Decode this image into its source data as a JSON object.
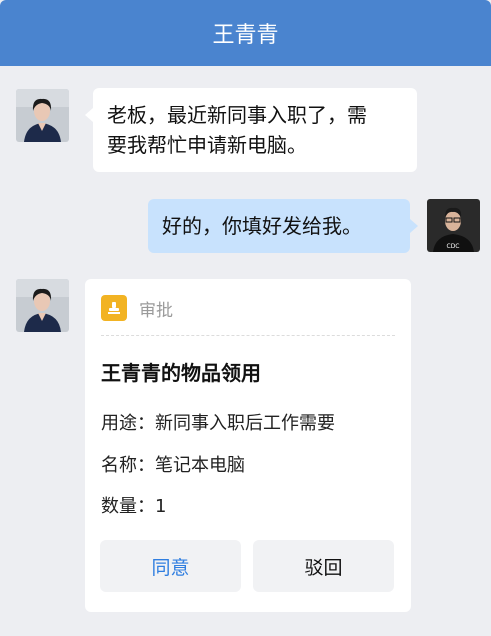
{
  "header": {
    "title": "王青青"
  },
  "messages": [
    {
      "side": "left",
      "text_line1": "老板，最近新同事入职了，需",
      "text_line2": "要我帮忙申请新电脑。"
    },
    {
      "side": "right",
      "text": "好的，你填好发给我。"
    }
  ],
  "avatars": {
    "me_shirt_text": "CDC"
  },
  "approval_card": {
    "tag": "审批",
    "tag_icon": "stamp-icon",
    "title": "王青青的物品领用",
    "rows": [
      {
        "label": "用途：",
        "value": "新同事入职后工作需要"
      },
      {
        "label": "名称：",
        "value": "笔记本电脑"
      },
      {
        "label": "数量：",
        "value": "1"
      }
    ],
    "buttons": {
      "agree": "同意",
      "reject": "驳回"
    }
  },
  "colors": {
    "header": "#4a84cf",
    "background": "#edeef2",
    "bubble_right": "#c8e2fd",
    "accent": "#2f7ee0",
    "tag_icon": "#f2b323"
  }
}
